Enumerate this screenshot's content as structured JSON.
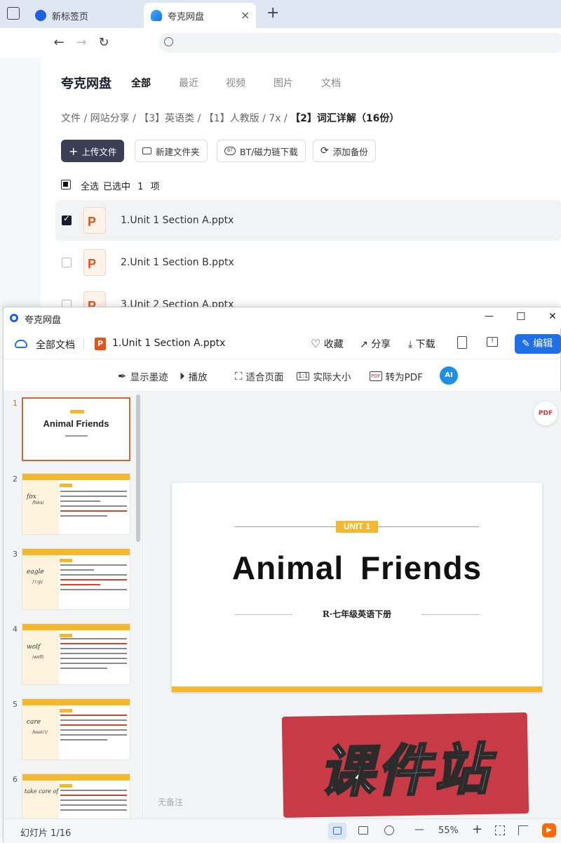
{
  "browser": {
    "tabs": [
      {
        "label": "新标签页",
        "active": false
      },
      {
        "label": "夸克网盘",
        "active": true
      }
    ],
    "new_tab_symbol": "+",
    "close_symbol": "×",
    "nav": {
      "back": "←",
      "forward": "→",
      "reload": "↻"
    },
    "search_icon": "search-icon"
  },
  "drive": {
    "brand": "夸克网盘",
    "tabs": [
      "全部",
      "最近",
      "视频",
      "图片",
      "文档"
    ],
    "active_tab": "全部",
    "breadcrumb": [
      "文件",
      "网站分享",
      "【3】英语类",
      "【1】人教版",
      "7x",
      "【2】词汇详解（16份）"
    ],
    "crumb_sep": "/",
    "actions": {
      "upload": "上传文件",
      "new_folder": "新建文件夹",
      "bt_download": "BT/磁力链下载",
      "add_backup": "添加备份"
    },
    "select_all": "全选",
    "selected_prefix": "已选中",
    "selected_count": "1",
    "selected_unit": "项",
    "files": [
      {
        "name": "1.Unit 1 Section A.pptx",
        "checked": true
      },
      {
        "name": "2.Unit 1 Section B.pptx",
        "checked": false
      },
      {
        "name": "3.Unit 2 Section A.pptx",
        "checked": false
      }
    ]
  },
  "viewer": {
    "window_title": "夸克网盘",
    "win_controls": {
      "min": "—",
      "max": "☐",
      "close": "✕"
    },
    "all_docs": "全部文档",
    "file_name": "1.Unit 1 Section A.pptx",
    "actions": {
      "favorite": "收藏",
      "share": "分享",
      "download": "下载",
      "edit": "编辑"
    },
    "tools": {
      "ink": "显示墨迹",
      "play": "播放",
      "fit_page": "适合页面",
      "actual_size": "实际大小",
      "to_pdf": "转为PDF",
      "ai": "AI"
    },
    "thumbnails": [
      {
        "num": "1",
        "title": "Animal  Friends",
        "selected": true
      },
      {
        "num": "2",
        "word": "fox",
        "pron": "/fɒks/"
      },
      {
        "num": "3",
        "word": "eagle",
        "pron": "/ˈiːɡl/"
      },
      {
        "num": "4",
        "word": "wolf",
        "pron": "/wʊlf/"
      },
      {
        "num": "5",
        "word": "care",
        "pron": "/keə(r)/"
      },
      {
        "num": "6",
        "word": "take care of",
        "pron": ""
      }
    ],
    "slide": {
      "badge": "UNIT 1",
      "title": "Animal  Friends",
      "subtitle": "R·七年级英语下册"
    },
    "watermark": "课件站",
    "notes_placeholder": "无备注",
    "pdf_badge": "PDF",
    "status": {
      "slide_label": "幻灯片 1/16",
      "zoom": "55%",
      "zoom_out": "—",
      "zoom_in": "+"
    }
  },
  "colors": {
    "accent_blue": "#1f6fe5",
    "brand_dark": "#3a3f55",
    "slide_yellow": "#f3b82e",
    "watermark_red": "#c83a45",
    "ppt_orange": "#e2541b"
  }
}
